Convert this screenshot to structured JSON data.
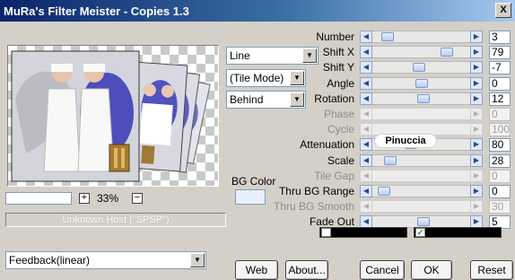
{
  "window": {
    "title": "MuRa's Filter Meister - Copies 1.3",
    "close_label": "X"
  },
  "zoom": {
    "value": "33%",
    "plus": "+",
    "minus": "−"
  },
  "host_status": "Unknown Host (\"SPSP\")",
  "combos": {
    "pattern": "Line",
    "tile_mode": "(Tile Mode)",
    "placement": "Behind",
    "feedback": "Feedback(linear)"
  },
  "bg_color": {
    "label": "BG Color",
    "swatch_color": "#e8f0ff"
  },
  "params": [
    {
      "label": "Number",
      "value": "3",
      "enabled": true,
      "pos": 0.1
    },
    {
      "label": "Shift X",
      "value": "79",
      "enabled": true,
      "pos": 0.8
    },
    {
      "label": "Shift Y",
      "value": "-7",
      "enabled": true,
      "pos": 0.47
    },
    {
      "label": "Angle",
      "value": "0",
      "enabled": true,
      "pos": 0.5
    },
    {
      "label": "Rotation",
      "value": "12",
      "enabled": true,
      "pos": 0.53
    },
    {
      "label": "Phase",
      "value": "0",
      "enabled": false,
      "pos": null
    },
    {
      "label": "Cycle",
      "value": "100",
      "enabled": false,
      "pos": null
    },
    {
      "label": "Attenuation",
      "value": "80",
      "enabled": true,
      "pos": 0.38
    },
    {
      "label": "Scale",
      "value": "28",
      "enabled": true,
      "pos": 0.14
    },
    {
      "label": "Tile Gap",
      "value": "0",
      "enabled": false,
      "pos": null
    },
    {
      "label": "Thru BG Range",
      "value": "0",
      "enabled": true,
      "pos": 0.06
    },
    {
      "label": "Thru BG Smooth",
      "value": "30",
      "enabled": false,
      "pos": null
    },
    {
      "label": "Fade Out",
      "value": "5",
      "enabled": true,
      "pos": 0.53
    }
  ],
  "watermark": "Pinuccia",
  "color_bars": {
    "left_checked": false,
    "right_checked": true
  },
  "buttons": {
    "web": "Web",
    "about": "About...",
    "cancel": "Cancel",
    "ok": "OK",
    "reset": "Reset"
  },
  "colors": {
    "title_start": "#0a246a",
    "title_end": "#a6caf0",
    "window_bg": "#d4d0c8"
  }
}
